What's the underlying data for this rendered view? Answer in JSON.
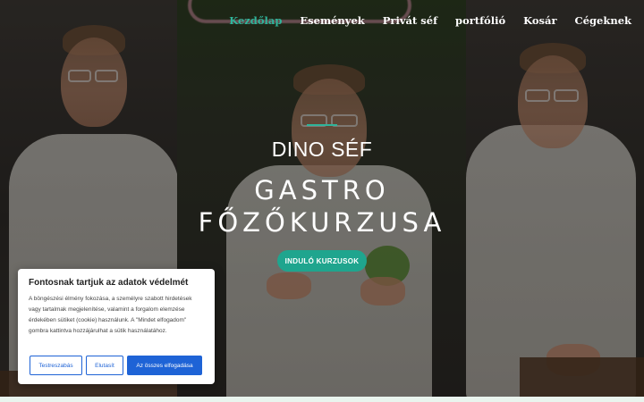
{
  "nav": {
    "items": [
      {
        "label": "Kezdőlap",
        "active": true
      },
      {
        "label": "Események"
      },
      {
        "label": "Privát séf"
      },
      {
        "label": "portfólió"
      },
      {
        "label": "Kosár"
      },
      {
        "label": "Cégeknek"
      }
    ]
  },
  "hero": {
    "subtitle": "DINO SÉF",
    "title_line1": "GASTRO",
    "title_line2": "FŐZŐKURZUSA",
    "cta_label": "INDULÓ KURZUSOK"
  },
  "cookie": {
    "title": "Fontosnak tartjuk az adatok védelmét",
    "text": "A böngészési élmény fokozása, a személyre szabott hirdetések vagy tartalmak megjelenítése, valamint a forgalom elemzése érdekében sütiket (cookie) használunk. A \"Mindet elfogadom\" gombra kattintva hozzájárulhat a sütik használatához.",
    "customize_label": "Testreszabás",
    "reject_label": "Elutasít",
    "accept_label": "Az összes elfogadása"
  },
  "colors": {
    "accent": "#2fb49a",
    "cta": "#1fa58e",
    "cookie_button": "#1e63d6"
  }
}
